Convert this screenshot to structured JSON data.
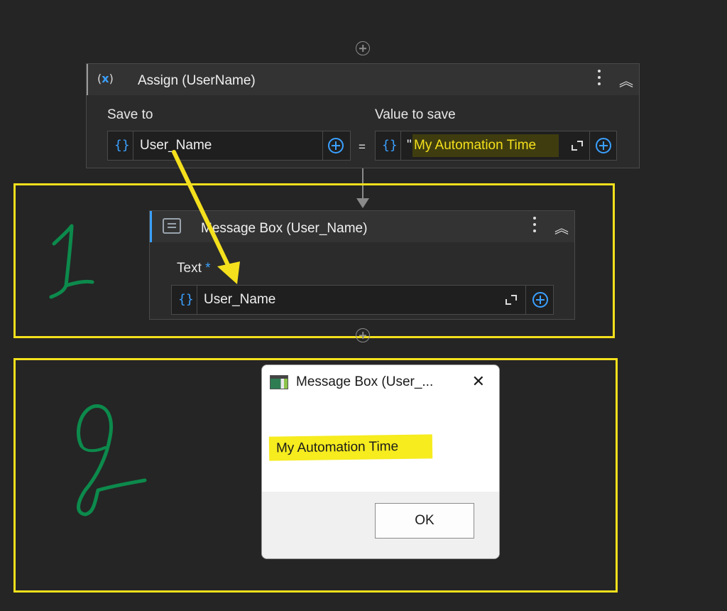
{
  "assign": {
    "title": "Assign (UserName)",
    "save_to_label": "Save to",
    "value_to_save_label": "Value to save",
    "save_to_value": "User_Name",
    "equals": "=",
    "value_quote": "\"",
    "value_text": "My Automation Time",
    "icon": "assign-variable-icon",
    "curly": "{}"
  },
  "message_box_activity": {
    "title": "Message Box  (User_Name)",
    "text_label": "Text",
    "required_marker": "*",
    "text_value": "User_Name",
    "icon": "message-box-icon",
    "curly": "{}"
  },
  "annotations": {
    "step1": "1",
    "step2": "2",
    "highlight_color": "#f4e01c",
    "handwriting_color": "#0c8a4c"
  },
  "dialog": {
    "title": "Message Box  (User_...",
    "close": "✕",
    "message": "My Automation Time",
    "ok_label": "OK"
  },
  "colors": {
    "background": "#252525",
    "accent_blue": "#3aa0ff",
    "highlight_yellow": "#f4e01c"
  }
}
